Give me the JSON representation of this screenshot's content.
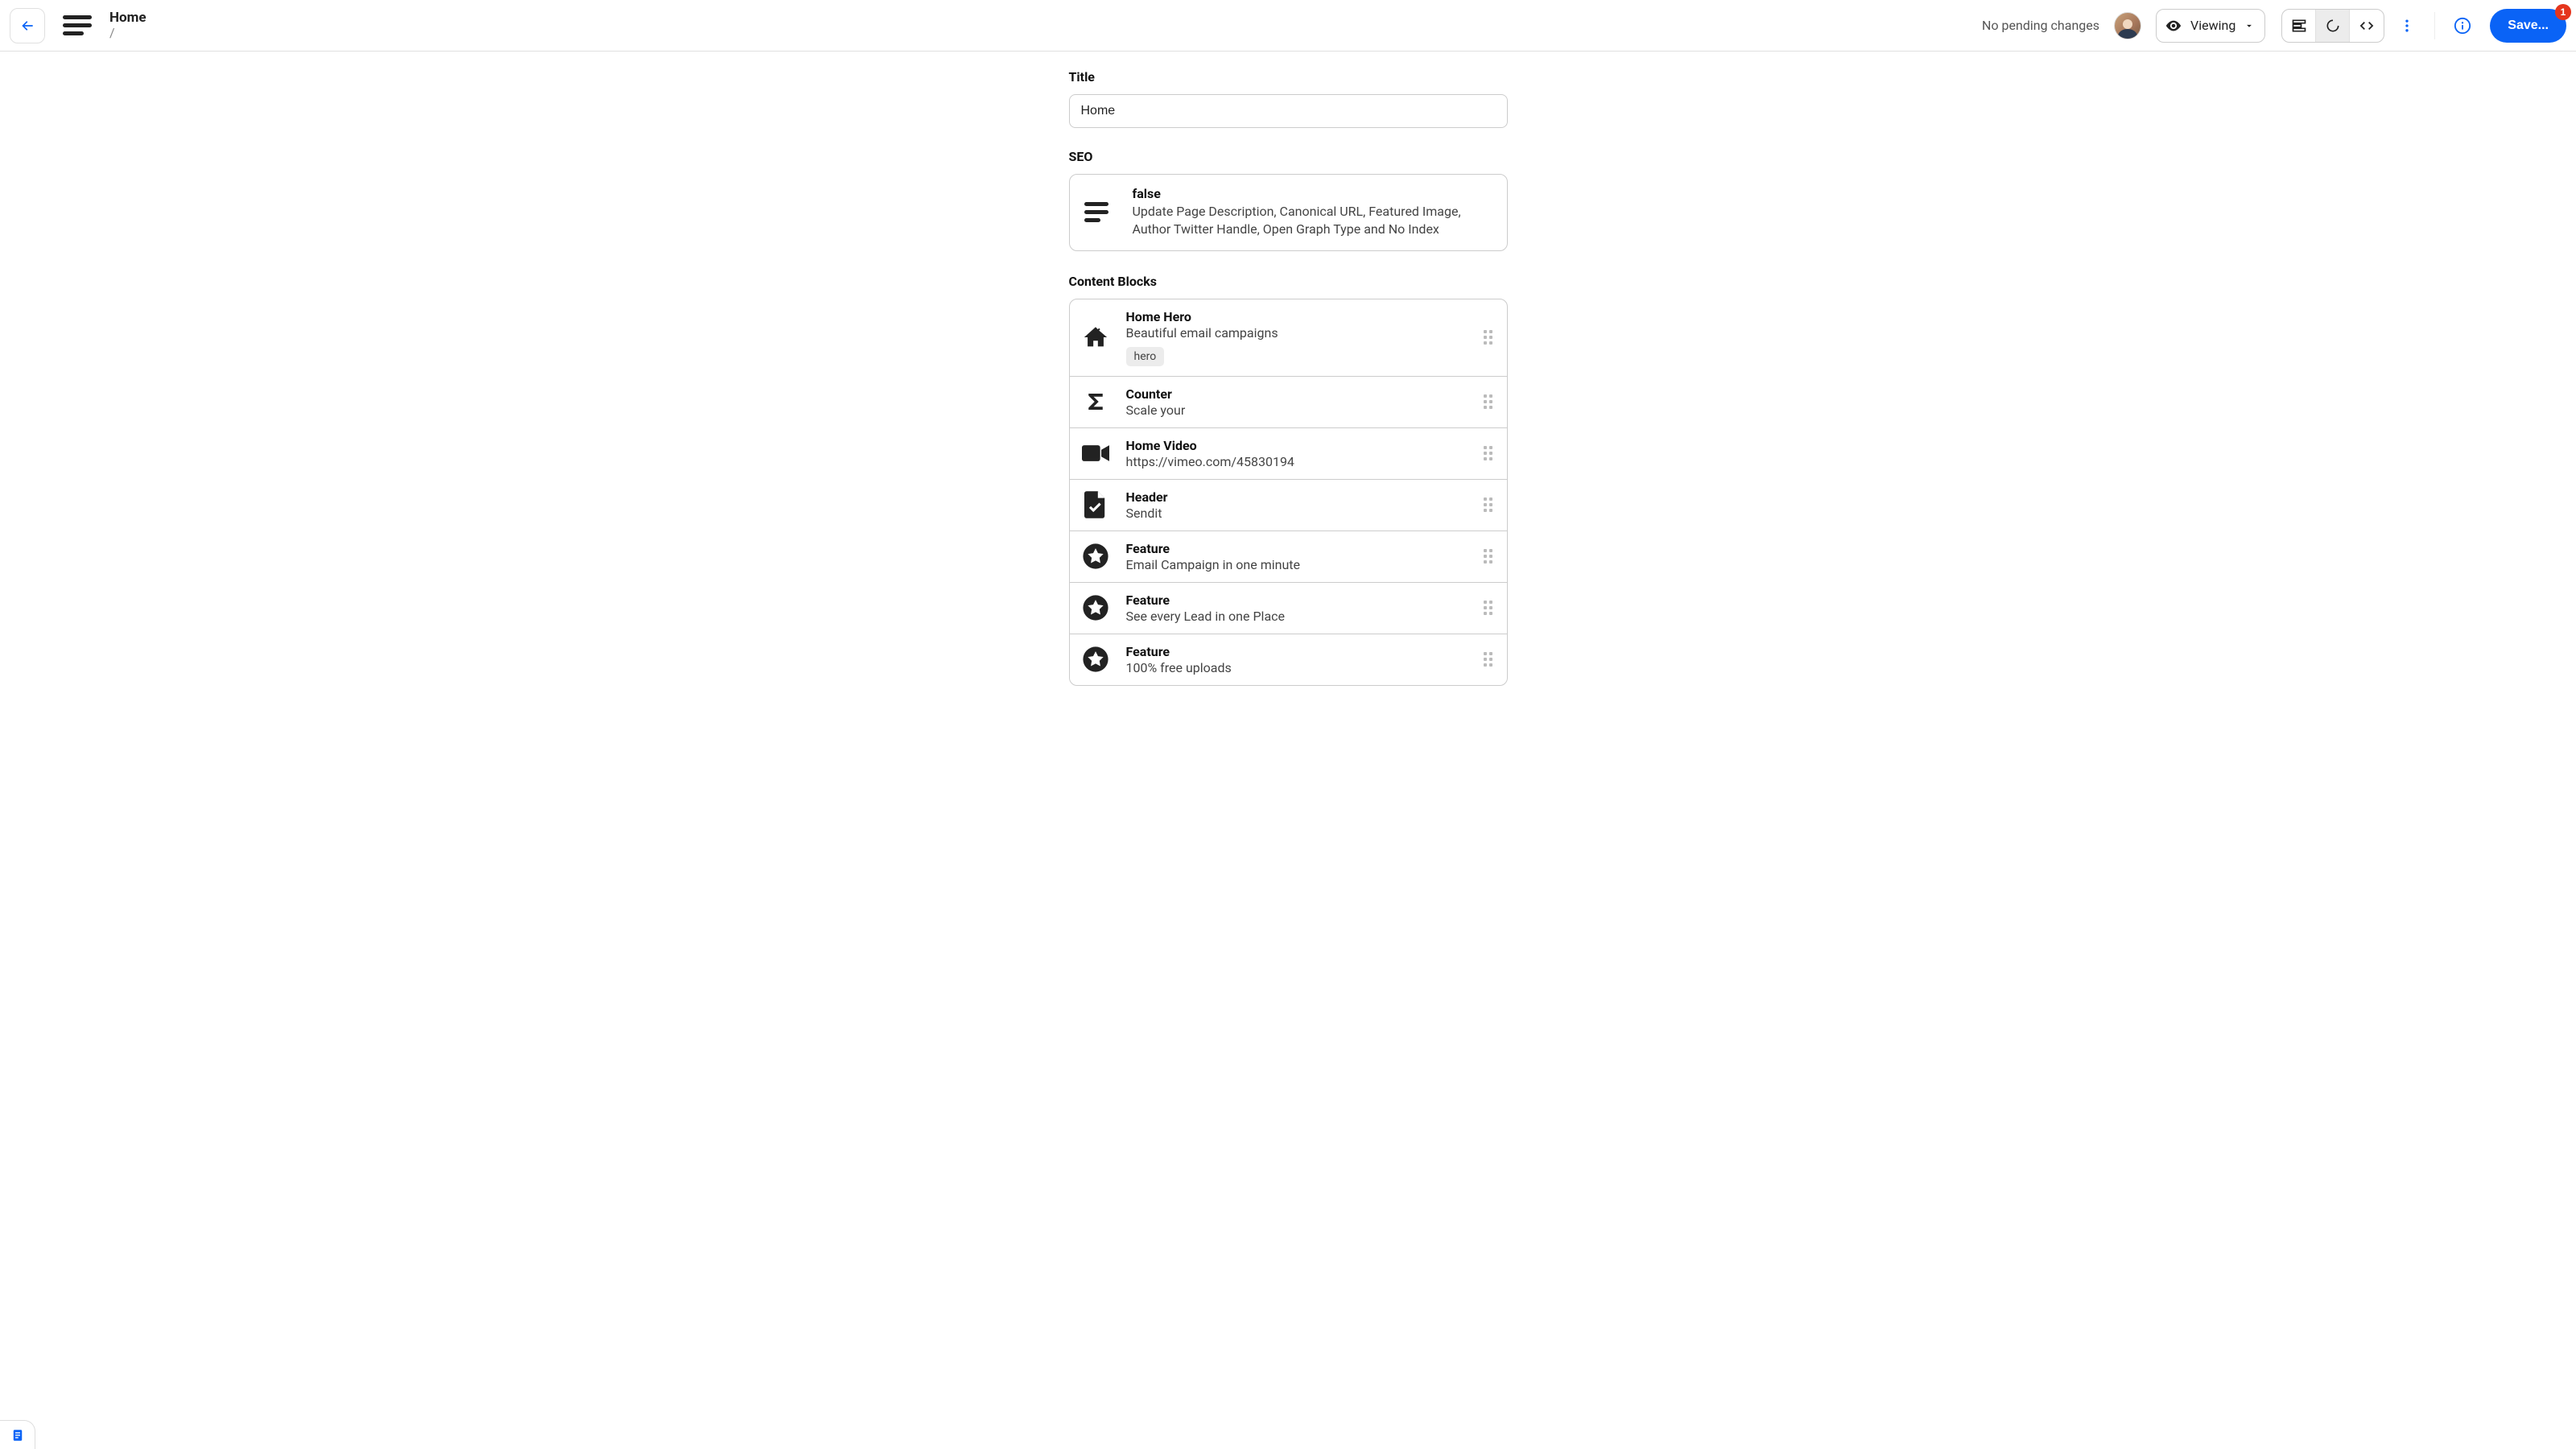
{
  "header": {
    "title": "Home",
    "breadcrumb": "/",
    "pending_label": "No pending changes",
    "viewing_label": "Viewing",
    "save_label": "Save...",
    "save_badge": "1"
  },
  "title_section": {
    "label": "Title",
    "value": "Home"
  },
  "seo_section": {
    "label": "SEO",
    "card_title": "false",
    "card_desc": "Update Page Description, Canonical URL, Featured Image, Author Twitter Handle, Open Graph Type and No Index"
  },
  "blocks_section": {
    "label": "Content Blocks",
    "items": [
      {
        "icon": "home",
        "title": "Home Hero",
        "sub": "Beautiful email campaigns",
        "tag": "hero"
      },
      {
        "icon": "sigma",
        "title": "Counter",
        "sub": "Scale your"
      },
      {
        "icon": "video",
        "title": "Home Video",
        "sub": "https://vimeo.com/45830194"
      },
      {
        "icon": "docchk",
        "title": "Header",
        "sub": "Sendit"
      },
      {
        "icon": "star",
        "title": "Feature",
        "sub": "Email Campaign in one minute"
      },
      {
        "icon": "star",
        "title": "Feature",
        "sub": "See every Lead in one Place"
      },
      {
        "icon": "star",
        "title": "Feature",
        "sub": "100% free uploads"
      }
    ]
  }
}
